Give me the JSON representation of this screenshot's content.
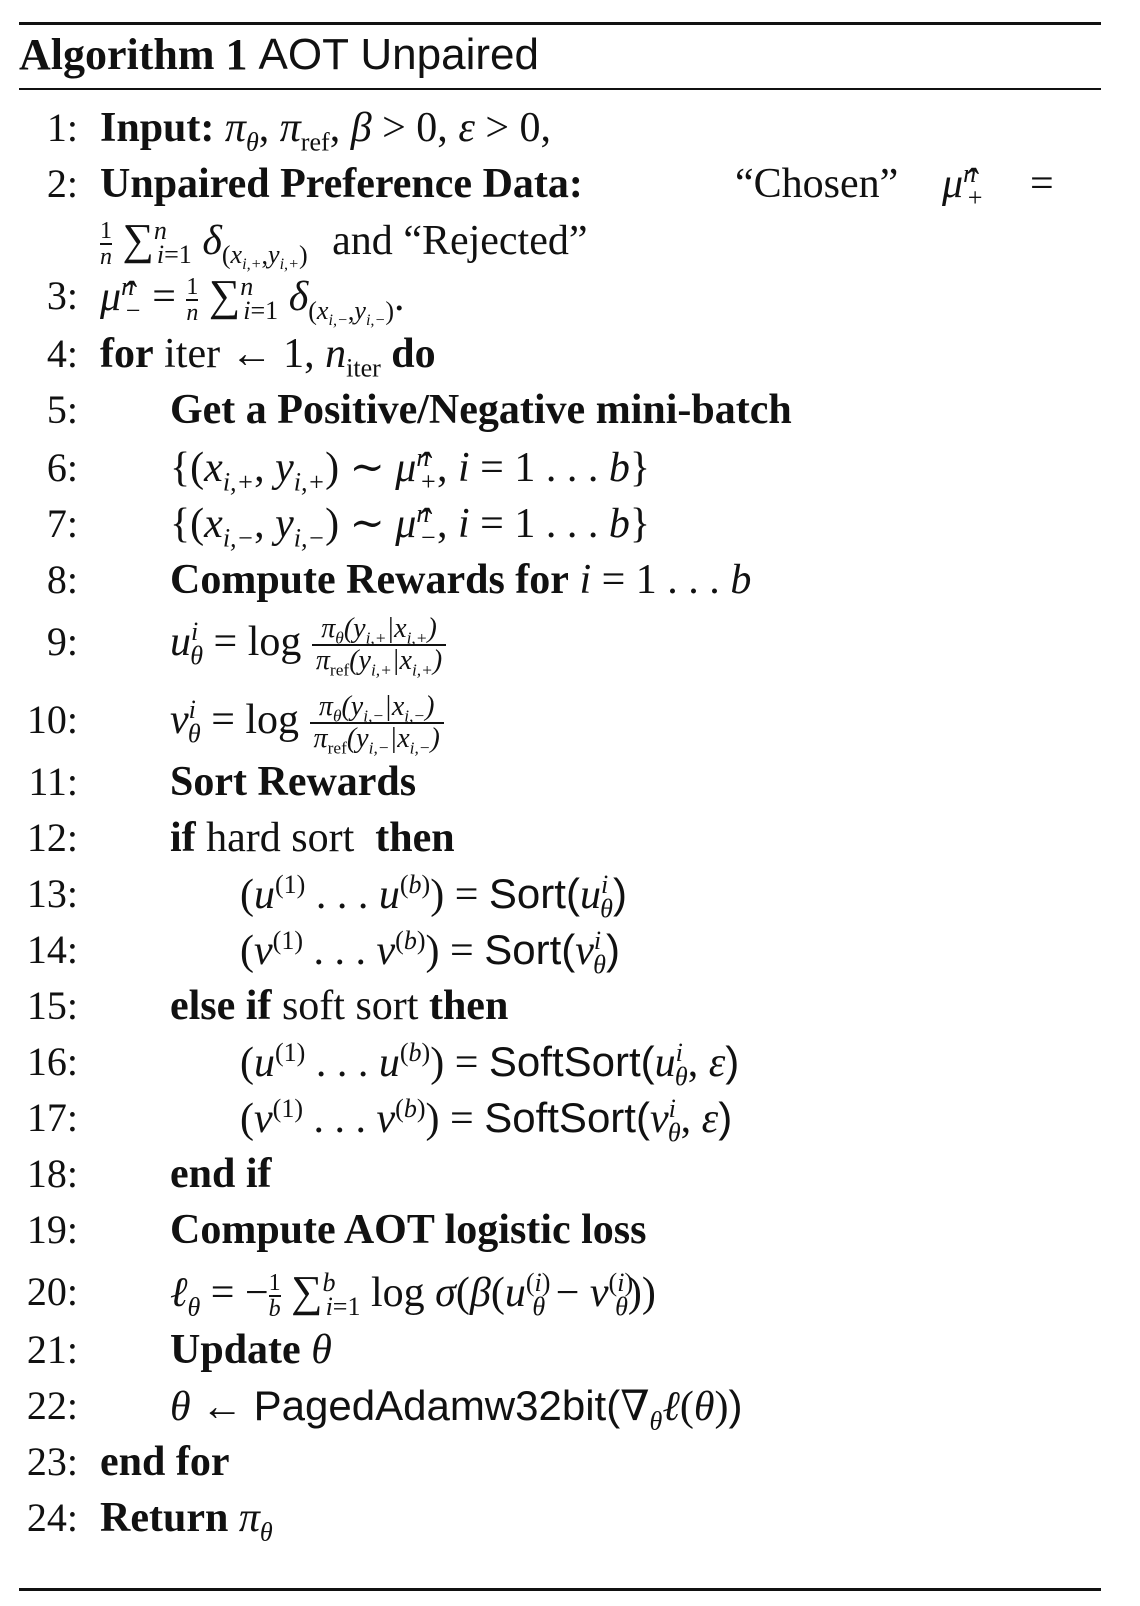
{
  "caption": {
    "label": "Algorithm 1",
    "title": "AOT Unpaired"
  },
  "lines": [
    {
      "n": "1:",
      "text": "Input: πθ, πref, β > 0, ε > 0,"
    },
    {
      "n": "2:",
      "text": "Unpaired Preference Data: “Chosen” μ̂ⁿ₊ ="
    },
    {
      "n": "",
      "text": "1/n Σ_{i=1}^{n} δ_(x_{i,+}, y_{i,+}) and “Rejected”"
    },
    {
      "n": "3:",
      "text": "μ̂ⁿ₋ = 1/n Σ_{i=1}^{n} δ_(x_{i,−}, y_{i,−})."
    },
    {
      "n": "4:",
      "text": "for iter ← 1, n_iter do"
    },
    {
      "n": "5:",
      "text": "Get a Positive/Negative mini-batch"
    },
    {
      "n": "6:",
      "text": "{(x_{i,+}, y_{i,+}) ∼ μ̂ⁿ₊, i = 1 . . . b}"
    },
    {
      "n": "7:",
      "text": "{(x_{i,−}, y_{i,−}) ∼ μ̂ⁿ₋, i = 1 . . . b}"
    },
    {
      "n": "8:",
      "text": "Compute Rewards for i = 1 . . . b"
    },
    {
      "n": "9:",
      "text": "u^i_θ = log πθ(y_{i,+}|x_{i,+}) / πref(y_{i,+}|x_{i,+})"
    },
    {
      "n": "10:",
      "text": "v^i_θ = log πθ(y_{i,−}|x_{i,−}) / πref(y_{i,−}|x_{i,−})"
    },
    {
      "n": "11:",
      "text": "Sort Rewards"
    },
    {
      "n": "12:",
      "text": "if hard sort then"
    },
    {
      "n": "13:",
      "text": "(u^(1) . . . u^(b)) = Sort(u^i_θ)"
    },
    {
      "n": "14:",
      "text": "(v^(1) . . . v^(b)) = Sort(v^i_θ)"
    },
    {
      "n": "15:",
      "text": "else if soft sort then"
    },
    {
      "n": "16:",
      "text": "(u^(1) . . . u^(b)) = SoftSort(u^i_θ, ε)"
    },
    {
      "n": "17:",
      "text": "(v^(1) . . . v^(b)) = SoftSort(v^i_θ, ε)"
    },
    {
      "n": "18:",
      "text": "end if"
    },
    {
      "n": "19:",
      "text": "Compute AOT logistic loss"
    },
    {
      "n": "20:",
      "text": "ℓθ = −1/b Σ_{i=1}^{b} log σ(β(u^(i)_θ − v^(i)_θ))"
    },
    {
      "n": "21:",
      "text": "Update θ"
    },
    {
      "n": "22:",
      "text": "θ ← PagedAdamw32bit(∇θ ℓ(θ))"
    },
    {
      "n": "23:",
      "text": "end for"
    },
    {
      "n": "24:",
      "text": "Return πθ"
    }
  ],
  "words": {
    "input": "Input:",
    "unpaired": "Unpaired Preference Data:",
    "chosen": "“Chosen”",
    "and": "and",
    "rejected": "“Rejected”",
    "for": "for",
    "iter": "iter",
    "do": "do",
    "get_batch": "Get a Positive/Negative mini-batch",
    "compute_rewards": "Compute Rewards for",
    "sort_rewards": "Sort Rewards",
    "if": "if",
    "hard_sort": "hard sort",
    "then": "then",
    "sort": "Sort",
    "else_if": "else if",
    "soft_sort": "soft sort",
    "softsort": "SoftSort",
    "end_if": "end if",
    "compute_loss": "Compute AOT logistic loss",
    "update": "Update",
    "optimizer": "PagedAdamw32bit",
    "end_for": "end for",
    "return": "Return",
    "log": "log",
    "ref": "ref"
  }
}
